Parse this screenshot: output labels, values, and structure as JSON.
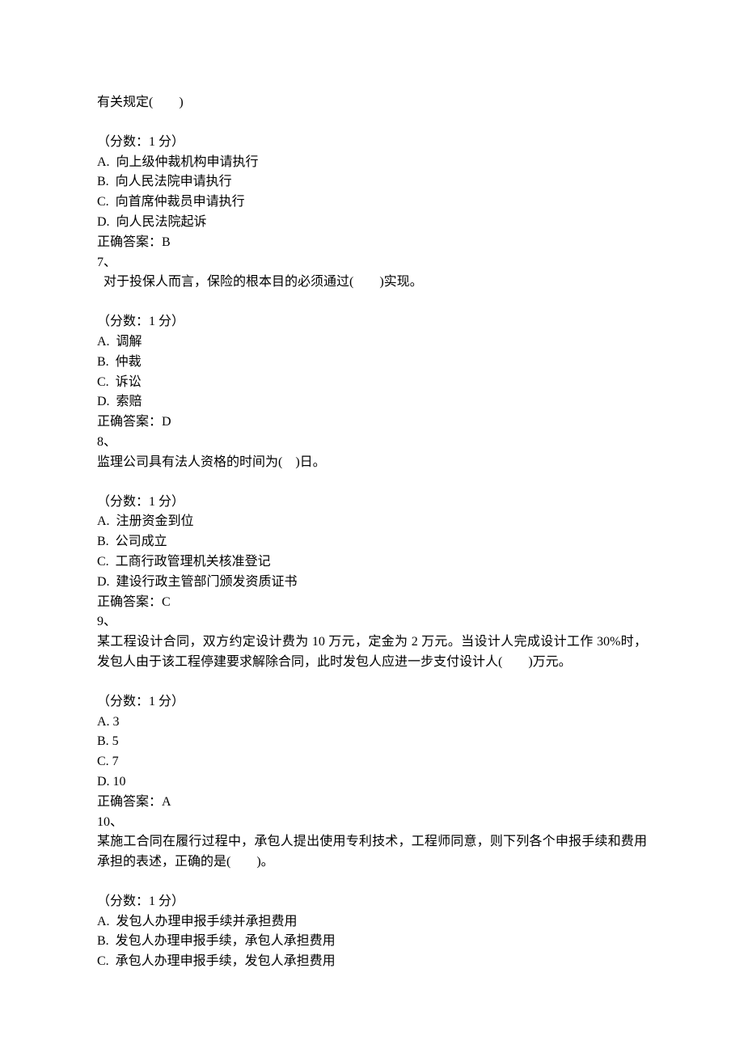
{
  "q6": {
    "stem_tail": "有关规定(　　)",
    "score": "（分数：1 分）",
    "A": "A.  向上级仲裁机构申请执行",
    "B": "B.  向人民法院申请执行",
    "C": "C.  向首席仲裁员申请执行",
    "D": "D.  向人民法院起诉",
    "ans": "正确答案：B"
  },
  "q7": {
    "num": "7、",
    "stem": "  对于投保人而言，保险的根本目的必须通过(　　)实现。",
    "score": "（分数：1 分）",
    "A": "A.  调解",
    "B": "B.  仲裁",
    "C": "C.  诉讼",
    "D": "D.  索赔",
    "ans": "正确答案：D"
  },
  "q8": {
    "num": "8、",
    "stem": "监理公司具有法人资格的时间为(　)日。",
    "score": "（分数：1 分）",
    "A": "A.  注册资金到位",
    "B": "B.  公司成立",
    "C": "C.  工商行政管理机关核准登记",
    "D": "D.  建设行政主管部门颁发资质证书",
    "ans": "正确答案：C"
  },
  "q9": {
    "num": "9、",
    "stem": "某工程设计合同，双方约定设计费为 10 万元，定金为 2 万元。当设计人完成设计工作 30%时，发包人由于该工程停建要求解除合同，此时发包人应进一步支付设计人(　　)万元。",
    "score": "（分数：1 分）",
    "A": "A. 3",
    "B": "B. 5",
    "C": "C. 7",
    "D": "D. 10",
    "ans": "正确答案：A"
  },
  "q10": {
    "num": "10、",
    "stem": "某施工合同在履行过程中，承包人提出使用专利技术，工程师同意，则下列各个申报手续和费用承担的表述，正确的是(　　)。",
    "score": "（分数：1 分）",
    "A": "A.  发包人办理申报手续并承担费用",
    "B": "B.  发包人办理申报手续，承包人承担费用",
    "C": "C.  承包人办理申报手续，发包人承担费用"
  }
}
